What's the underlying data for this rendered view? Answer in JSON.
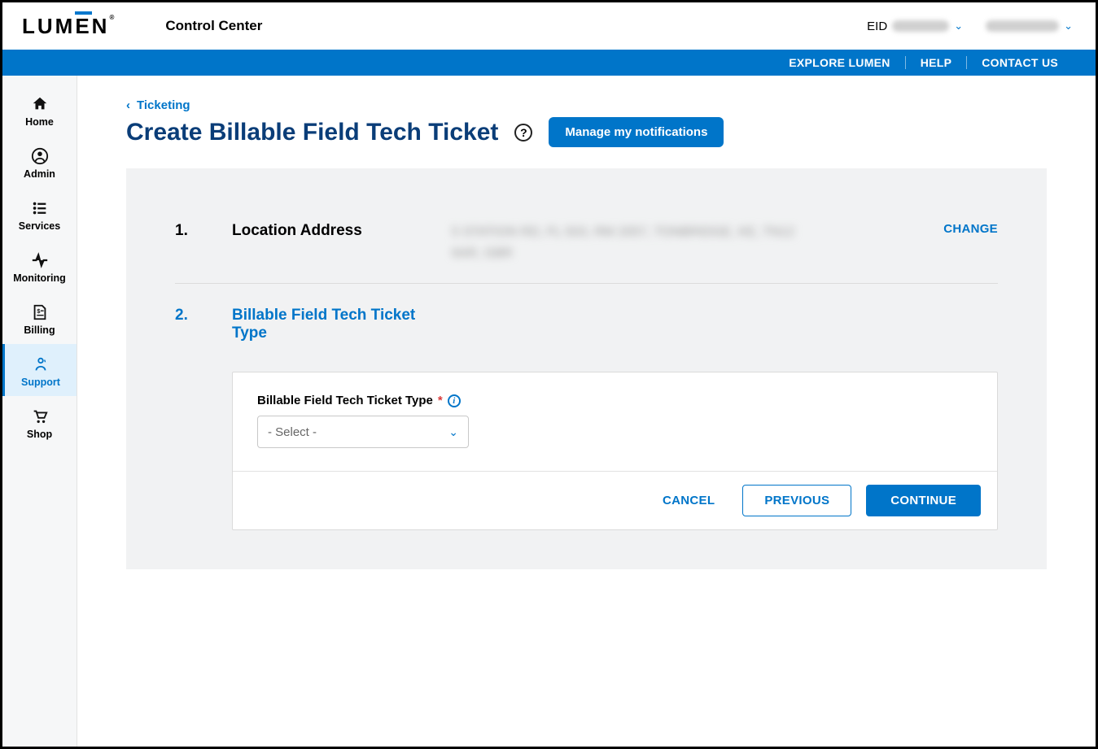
{
  "header": {
    "logo": "LUMEN",
    "app_title": "Control Center",
    "eid_label": "EID"
  },
  "navstrip": {
    "explore": "EXPLORE LUMEN",
    "help": "HELP",
    "contact": "CONTACT US"
  },
  "sidebar": {
    "items": [
      {
        "label": "Home"
      },
      {
        "label": "Admin"
      },
      {
        "label": "Services"
      },
      {
        "label": "Monitoring"
      },
      {
        "label": "Billing"
      },
      {
        "label": "Support"
      },
      {
        "label": "Shop"
      }
    ]
  },
  "breadcrumb": {
    "back_label": "Ticketing"
  },
  "page": {
    "title": "Create Billable Field Tech Ticket",
    "manage_notifications": "Manage my notifications"
  },
  "step1": {
    "num": "1.",
    "title": "Location Address",
    "address_blurred": "5 STATION RD, FL 503, RM 2057, TONBRIDGE, KE, TN12 6AR, GBR",
    "change": "CHANGE"
  },
  "step2": {
    "num": "2.",
    "title": "Billable Field Tech Ticket Type",
    "field_label": "Billable Field Tech Ticket Type",
    "select_placeholder": "- Select -"
  },
  "actions": {
    "cancel": "CANCEL",
    "previous": "PREVIOUS",
    "continue": "CONTINUE"
  }
}
